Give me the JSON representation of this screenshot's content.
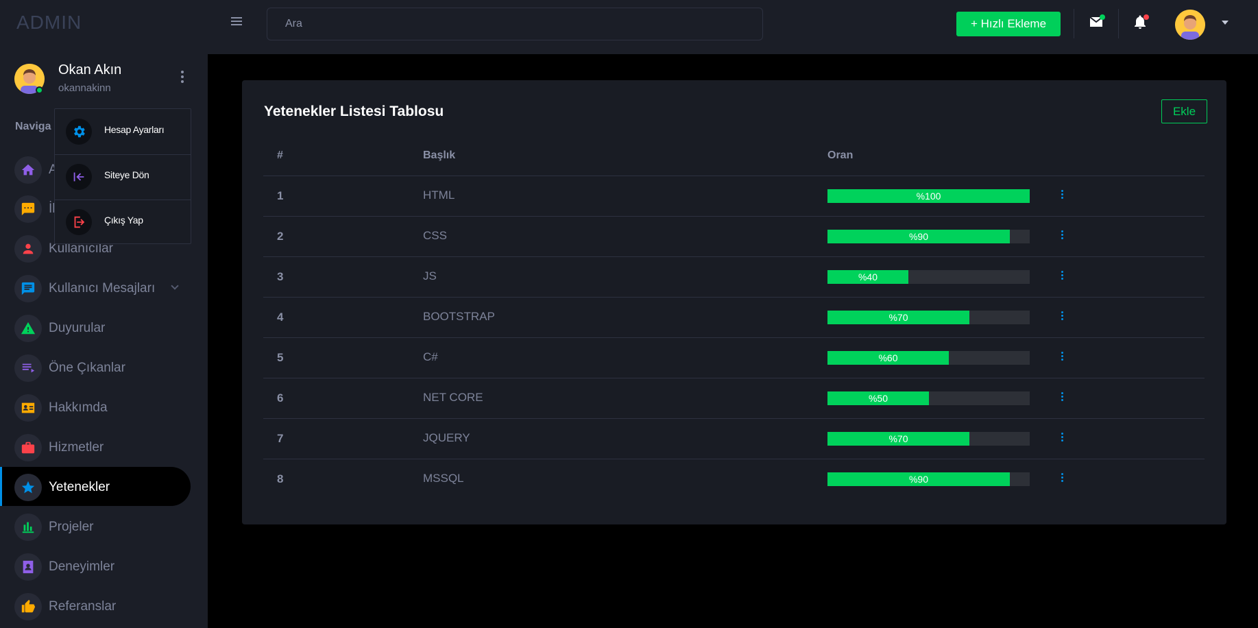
{
  "app": {
    "logo": "ADMIN"
  },
  "topbar": {
    "search_placeholder": "Ara",
    "quick_add_label": "+ Hızlı Ekleme"
  },
  "profile": {
    "name": "Okan Akın",
    "username": "okannakinn"
  },
  "profile_menu": {
    "items": [
      {
        "label": "Hesap Ayarları",
        "icon": "gear-icon",
        "color": "#0090e7"
      },
      {
        "label": "Siteye Dön",
        "icon": "back-arrow-icon",
        "color": "#8f5fe8"
      },
      {
        "label": "Çıkış Yap",
        "icon": "logout-icon",
        "color": "#fc424a"
      }
    ]
  },
  "sidebar": {
    "nav_title": "Naviga",
    "items": [
      {
        "label": "A",
        "icon": "home-icon",
        "color": "#8f5fe8"
      },
      {
        "label": "İl",
        "icon": "message-icon",
        "color": "#ffab00"
      },
      {
        "label": "Kullanıcılar",
        "icon": "user-icon",
        "color": "#fc424a"
      },
      {
        "label": "Kullanıcı Mesajları",
        "icon": "chat-icon",
        "color": "#0090e7",
        "has_submenu": true
      },
      {
        "label": "Duyurular",
        "icon": "warning-icon",
        "color": "#00d25b"
      },
      {
        "label": "Öne Çıkanlar",
        "icon": "list-icon",
        "color": "#8f5fe8"
      },
      {
        "label": "Hakkımda",
        "icon": "id-card-icon",
        "color": "#ffab00"
      },
      {
        "label": "Hizmetler",
        "icon": "briefcase-icon",
        "color": "#fc424a"
      },
      {
        "label": "Yetenekler",
        "icon": "star-icon",
        "color": "#0090e7",
        "active": true
      },
      {
        "label": "Projeler",
        "icon": "bar-chart-icon",
        "color": "#00d25b"
      },
      {
        "label": "Deneyimler",
        "icon": "contact-icon",
        "color": "#8f5fe8"
      },
      {
        "label": "Referanslar",
        "icon": "thumbs-up-icon",
        "color": "#ffab00"
      }
    ]
  },
  "card": {
    "title": "Yetenekler Listesi Tablosu",
    "add_label": "Ekle",
    "columns": [
      "#",
      "Başlık",
      "Oran"
    ],
    "rows": [
      {
        "num": "1",
        "name": "HTML",
        "percent": 100,
        "label": "%100"
      },
      {
        "num": "2",
        "name": "CSS",
        "percent": 90,
        "label": "%90"
      },
      {
        "num": "3",
        "name": "JS",
        "percent": 40,
        "label": "%40"
      },
      {
        "num": "4",
        "name": "BOOTSTRAP",
        "percent": 70,
        "label": "%70"
      },
      {
        "num": "5",
        "name": "C#",
        "percent": 60,
        "label": "%60"
      },
      {
        "num": "6",
        "name": "NET CORE",
        "percent": 50,
        "label": "%50"
      },
      {
        "num": "7",
        "name": "JQUERY",
        "percent": 70,
        "label": "%70"
      },
      {
        "num": "8",
        "name": "MSSQL",
        "percent": 90,
        "label": "%90"
      }
    ]
  },
  "colors": {
    "accent_green": "#00d25b",
    "accent_blue": "#0090e7",
    "notification_red": "#fc424a"
  }
}
